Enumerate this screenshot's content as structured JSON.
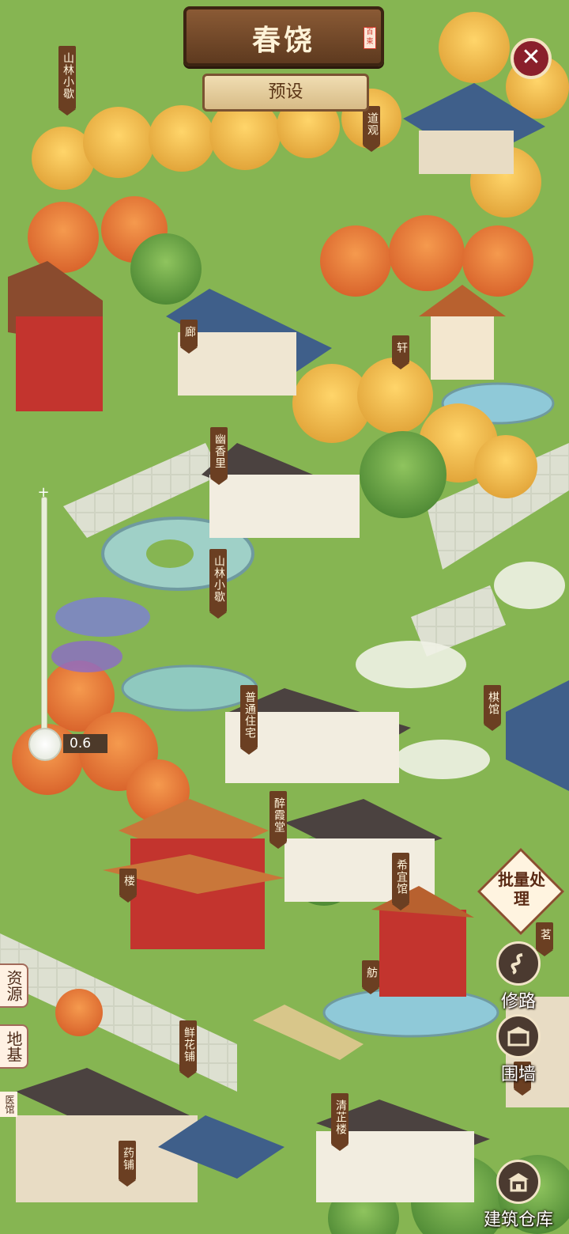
{
  "header": {
    "title": "春饶",
    "seal_text": "百束",
    "preset_label": "预设",
    "close_label": "✕"
  },
  "zoom": {
    "value_label": "0.6",
    "plus_label": "+"
  },
  "labels": {
    "l1": "山林小歇",
    "l2": "道观",
    "l3": "廊",
    "l4": "轩",
    "l5": "幽香里",
    "l6": "山林小歇",
    "l7": "普通住宅",
    "l8": "棋馆",
    "l9": "醉霞堂",
    "l10": "楼",
    "l11": "希宜馆",
    "l12": "舫",
    "l13": "鲜花铺",
    "l14": "清芷楼",
    "l15": "药铺",
    "l16": "茗",
    "l17": "堂"
  },
  "left_tabs": {
    "resources": "资源",
    "foundation": "地基",
    "clinic": "医馆"
  },
  "tools": {
    "batch": "批量处理",
    "road": "修路",
    "wall": "围墙",
    "warehouse": "建筑仓库"
  },
  "colors": {
    "grass": "#7fae4c",
    "label_bg": "#6b3f22",
    "close_bg": "#8a1f2b"
  }
}
